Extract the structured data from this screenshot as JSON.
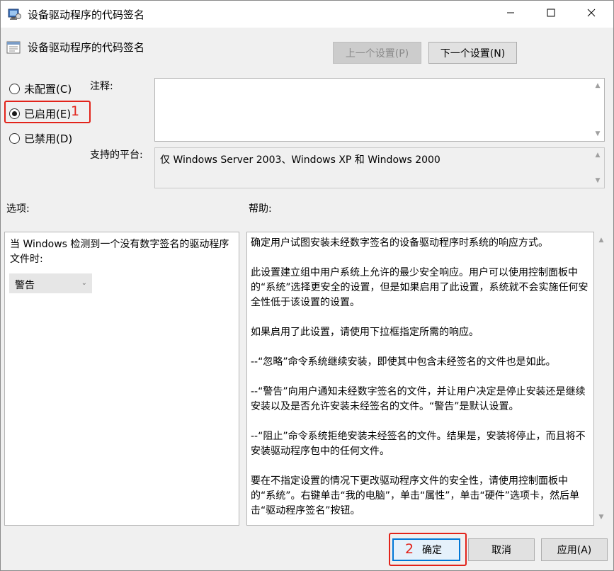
{
  "window": {
    "title": "设备驱动程序的代码签名",
    "minimize_icon": "minimize-icon",
    "maximize_icon": "maximize-icon",
    "close_icon": "close-icon"
  },
  "policy": {
    "title": "设备驱动程序的代码签名",
    "prev_label": "上一个设置(P)",
    "next_label": "下一个设置(N)"
  },
  "state": {
    "options": [
      {
        "label": "未配置(C)",
        "checked": false
      },
      {
        "label": "已启用(E)",
        "checked": true
      },
      {
        "label": "已禁用(D)",
        "checked": false
      }
    ],
    "callout_1": "1"
  },
  "comment": {
    "label": "注释:",
    "value": ""
  },
  "platform": {
    "label": "支持的平台:",
    "value": "仅 Windows Server 2003、Windows XP 和 Windows 2000"
  },
  "options_section": {
    "label": "选项:",
    "prompt": "当 Windows 检测到一个没有数字签名的驱动程序文件时:",
    "dropdown_value": "警告"
  },
  "help_section": {
    "label": "帮助:",
    "paragraphs": [
      "确定用户试图安装未经数字签名的设备驱动程序时系统的响应方式。",
      "此设置建立组中用户系统上允许的最少安全响应。用户可以使用控制面板中的“系统”选择更安全的设置，但是如果启用了此设置，系统就不会实施任何安全性低于该设置的设置。",
      "如果启用了此设置，请使用下拉框指定所需的响应。",
      "--“忽略”命令系统继续安装，即使其中包含未经签名的文件也是如此。",
      "--“警告”向用户通知未经数字签名的文件，并让用户决定是停止安装还是继续安装以及是否允许安装未经签名的文件。“警告”是默认设置。",
      "--“阻止”命令系统拒绝安装未经签名的文件。结果是，安装将停止，而且将不安装驱动程序包中的任何文件。",
      "要在不指定设置的情况下更改驱动程序文件的安全性，请使用控制面板中的“系统”。右键单击“我的电脑”，单击“属性”，单击“硬件”选项卡，然后单击“驱动程序签名”按钮。"
    ]
  },
  "footer": {
    "ok_label": "确定",
    "cancel_label": "取消",
    "apply_label": "应用(A)",
    "callout_2": "2"
  },
  "colors": {
    "accent": "#0078d7",
    "callout": "#e2231a"
  }
}
